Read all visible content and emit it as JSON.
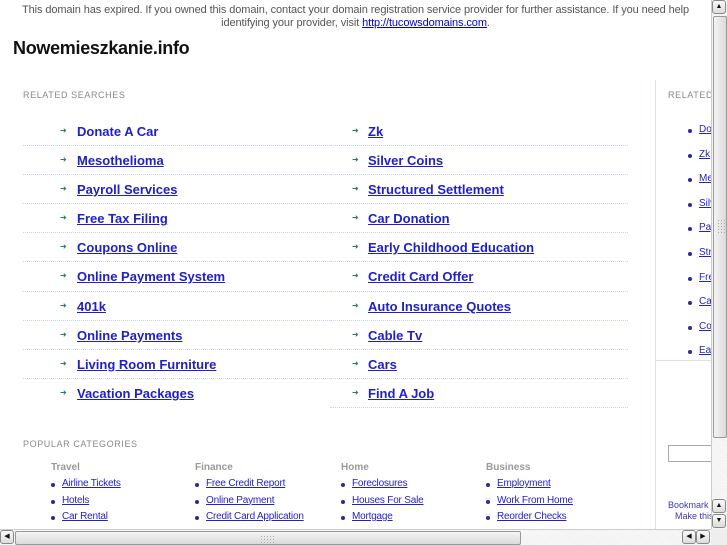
{
  "notice": {
    "text_before": "This domain has expired. If you owned this domain, contact your domain registration service provider for further assistance. If you need help identifying your provider, visit ",
    "link": "http://tucowsdomains.com",
    "text_after": "."
  },
  "site_title": "Nowemieszkanie.info",
  "related_searches": {
    "label": "RELATED SEARCHES",
    "left": [
      "Donate A Car",
      "Mesothelioma",
      "Payroll Services",
      "Free Tax Filing",
      "Coupons Online",
      "Online Payment System",
      "401k",
      "Online Payments",
      "Living Room Furniture",
      "Vacation Packages"
    ],
    "right": [
      "Zk",
      "Silver Coins",
      "Structured Settlement",
      "Car Donation",
      "Early Childhood Education",
      "Credit Card Offer",
      "Auto Insurance Quotes",
      "Cable Tv",
      "Cars",
      "Find A Job"
    ]
  },
  "popular_categories": {
    "label": "POPULAR CATEGORIES",
    "columns": [
      {
        "heading": "Travel",
        "links": [
          "Airline Tickets",
          "Hotels",
          "Car Rental"
        ]
      },
      {
        "heading": "Finance",
        "links": [
          "Free Credit Report",
          "Online Payment",
          "Credit Card Application"
        ]
      },
      {
        "heading": "Home",
        "links": [
          "Foreclosures",
          "Houses For Sale",
          "Mortgage"
        ]
      },
      {
        "heading": "Business",
        "links": [
          "Employment",
          "Work From Home",
          "Reorder Checks"
        ]
      }
    ]
  },
  "sidebar": {
    "label": "RELATED",
    "links": [
      "Donate A Car",
      "Zk",
      "Mesothelioma",
      "Silver Coins",
      "Payroll Services",
      "Structured Settlement",
      "Free Tax Filing",
      "Car Donation",
      "Coupons Online",
      "Early Childhood Education"
    ],
    "bookmark": "Bookmark",
    "make": "Make this"
  },
  "scrollbar": {
    "up": "▲",
    "down": "▼",
    "left": "◀",
    "right": "▶"
  }
}
